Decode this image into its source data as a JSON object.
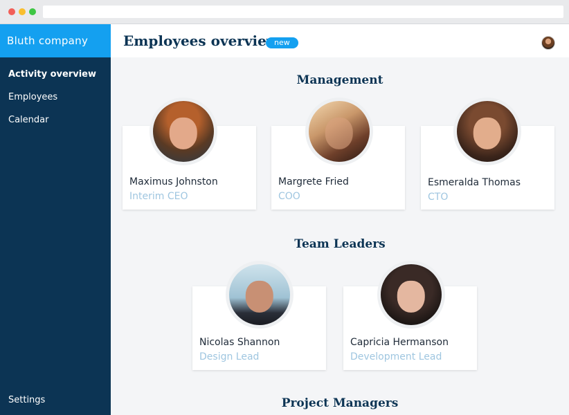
{
  "app": {
    "brand": "Bluth company"
  },
  "sidebar": {
    "items": [
      {
        "label": "Activity overview"
      },
      {
        "label": "Employees"
      },
      {
        "label": "Calendar"
      }
    ],
    "settings_label": "Settings"
  },
  "header": {
    "title": "Employees overview",
    "badge": "new"
  },
  "sections": {
    "management": {
      "title": "Management",
      "people": [
        {
          "name": "Maximus Johnston",
          "role": "Interim CEO"
        },
        {
          "name": "Margrete Fried",
          "role": "COO"
        },
        {
          "name": "Esmeralda Thomas",
          "role": "CTO"
        }
      ]
    },
    "team_leaders": {
      "title": "Team Leaders",
      "people": [
        {
          "name": "Nicolas Shannon",
          "role": "Design Lead"
        },
        {
          "name": "Capricia Hermanson",
          "role": "Development Lead"
        }
      ]
    },
    "project_managers": {
      "title": "Project Managers"
    }
  },
  "colors": {
    "sidebar": "#0c3454",
    "accent": "#14a0f0",
    "role_text": "#9fc6e0",
    "background": "#f4f5f7"
  }
}
